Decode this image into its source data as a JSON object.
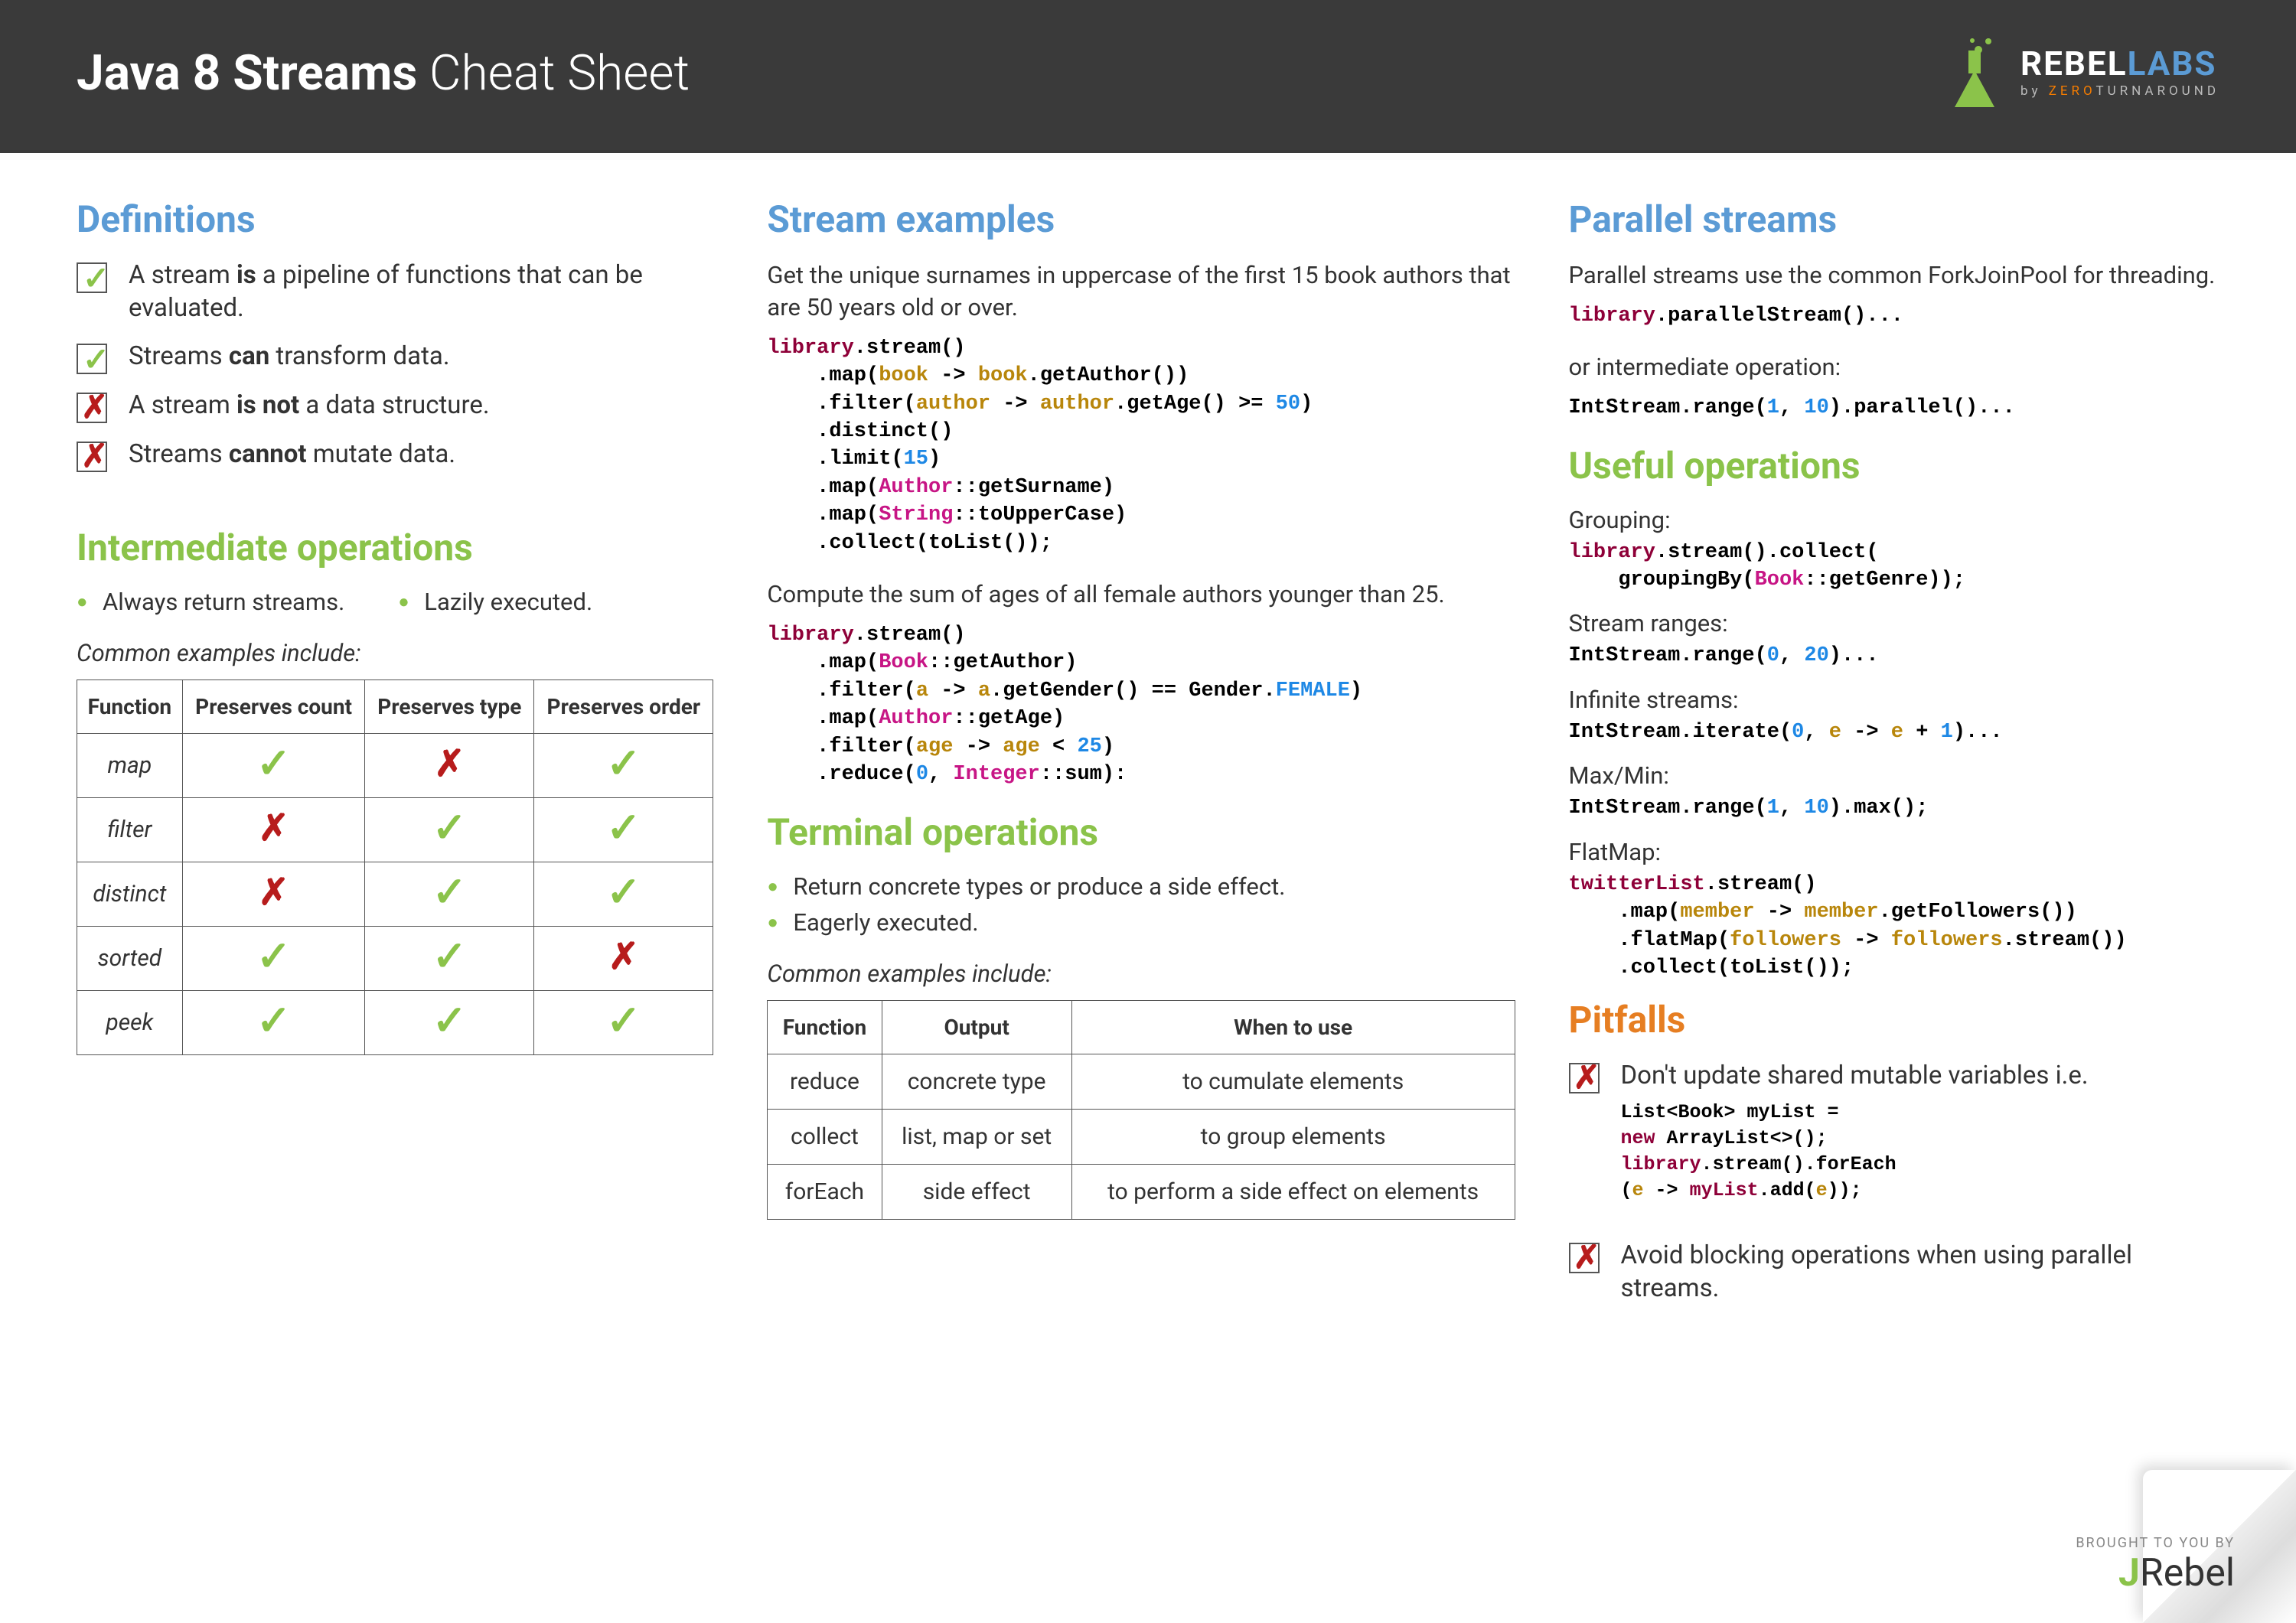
{
  "header": {
    "title_bold": "Java 8 Streams",
    "title_light": " Cheat Sheet",
    "logo_main": "REBEL",
    "logo_labs": "LABS",
    "logo_sub_by": "by ",
    "logo_sub_zero": "ZERO",
    "logo_sub_turn": "TURNAROUND"
  },
  "definitions": {
    "heading": "Definitions",
    "items": [
      {
        "ok": true,
        "html": "A stream <b>is</b> a pipeline of functions that can be evaluated."
      },
      {
        "ok": true,
        "html": "Streams <b>can</b> transform data."
      },
      {
        "ok": false,
        "html": "A stream <b>is not</b> a data structure."
      },
      {
        "ok": false,
        "html": "Streams <b>cannot</b> mutate data."
      }
    ]
  },
  "intermediate": {
    "heading": "Intermediate operations",
    "bullets": [
      "Always return streams.",
      "Lazily executed."
    ],
    "subhead": "Common examples include:",
    "table": {
      "headers": [
        "Function",
        "Preserves count",
        "Preserves type",
        "Preserves order"
      ],
      "rows": [
        {
          "fn": "map",
          "cells": [
            "✓",
            "✗",
            "✓"
          ]
        },
        {
          "fn": "filter",
          "cells": [
            "✗",
            "✓",
            "✓"
          ]
        },
        {
          "fn": "distinct",
          "cells": [
            "✗",
            "✓",
            "✓"
          ]
        },
        {
          "fn": "sorted",
          "cells": [
            "✓",
            "✓",
            "✗"
          ]
        },
        {
          "fn": "peek",
          "cells": [
            "✓",
            "✓",
            "✓"
          ]
        }
      ]
    }
  },
  "examples": {
    "heading": "Stream examples",
    "ex1_desc": "Get the unique surnames in uppercase of the first 15 book authors that are 50 years old or over.",
    "ex1_code": "<span class='c-obj'>library</span>.<b>stream()</b>\n    .<b>map</b>(<span class='c-var'>book</span> -&gt; <span class='c-var'>book</span>.getAuthor())\n    .<b>filter</b>(<span class='c-var'>author</span> -&gt; <span class='c-var'>author</span>.getAge() &gt;= <span class='c-num'>50</span>)\n    .<b>distinct</b>()\n    .<b>limit</b>(<span class='c-num'>15</span>)\n    .<b>map</b>(<span class='c-cls'>Author</span>::getSurname)\n    .<b>map</b>(<span class='c-cls'>String</span>::toUpperCase)\n    .<b>collect</b>(toList());",
    "ex2_desc": "Compute the sum of ages of all female authors younger than 25.",
    "ex2_code": "<span class='c-obj'>library</span>.<b>stream()</b>\n    .<b>map</b>(<span class='c-cls'>Book</span>::getAuthor)\n    .<b>filter</b>(<span class='c-var'>a</span> -&gt; <span class='c-var'>a</span>.getGender() == Gender.<span class='c-const'>FEMALE</span>)\n    .<b>map</b>(<span class='c-cls'>Author</span>::getAge)\n    .<b>filter</b>(<span class='c-var'>age</span> -&gt; <span class='c-var'>age</span> &lt; <span class='c-num'>25</span>)\n    .<b>reduce</b>(<span class='c-num'>0</span>, <span class='c-cls'>Integer</span>::sum):"
  },
  "terminal": {
    "heading": "Terminal operations",
    "bullets": [
      "Return concrete types or produce a side effect.",
      "Eagerly executed."
    ],
    "subhead": "Common examples include:",
    "table": {
      "headers": [
        "Function",
        "Output",
        "When to use"
      ],
      "rows": [
        {
          "fn": "reduce",
          "out": "concrete type",
          "use": "to cumulate elements"
        },
        {
          "fn": "collect",
          "out": "list, map or set",
          "use": "to group elements"
        },
        {
          "fn": "forEach",
          "out": "side effect",
          "use": "to perform a side effect on elements"
        }
      ]
    }
  },
  "parallel": {
    "heading": "Parallel streams",
    "desc1": "Parallel streams use the common ForkJoinPool for threading.",
    "code1": "<span class='c-obj'>library</span>.<b>parallelStream()</b>...",
    "desc2": "or intermediate operation:",
    "code2": "<b>IntStream.range</b>(<span class='c-num'>1</span>, <span class='c-num'>10</span>).<b>parallel()</b>..."
  },
  "useful": {
    "heading": "Useful operations",
    "ops": [
      {
        "label": "Grouping:",
        "code": "<span class='c-obj'>library</span>.<b>stream().collect(</b>\n    <b>groupingBy</b>(<span class='c-cls'>Book</span>::getGenre));"
      },
      {
        "label": "Stream ranges:",
        "code": "<b>IntStream.range</b>(<span class='c-num'>0</span>, <span class='c-num'>20</span>)..."
      },
      {
        "label": "Infinite streams:",
        "code": "<b>IntStream.iterate</b>(<span class='c-num'>0</span>, <span class='c-var'>e</span> -&gt; <span class='c-var'>e</span> + <span class='c-num'>1</span>)..."
      },
      {
        "label": "Max/Min:",
        "code": "<b>IntStream.range</b>(<span class='c-num'>1</span>, <span class='c-num'>10</span>).<b>max()</b>;"
      },
      {
        "label": "FlatMap:",
        "code": "<span class='c-obj'>twitterList</span>.<b>stream()</b>\n    .<b>map</b>(<span class='c-var'>member</span> -&gt; <span class='c-var'>member</span>.getFollowers())\n    .<b>flatMap</b>(<span class='c-var'>followers</span> -&gt; <span class='c-var'>followers</span>.stream())\n    .<b>collect</b>(toList());"
      }
    ]
  },
  "pitfalls": {
    "heading": "Pitfalls",
    "items": [
      {
        "text": "Don't update shared mutable variables i.e.",
        "code": "<b>List&lt;Book&gt; myList =</b>\n<span class='c-obj'>new</span> <b>ArrayList&lt;&gt;();</b>\n<span class='c-obj'>library</span>.<b>stream().forEach</b>\n(<span class='c-var'>e</span> -&gt; <span class='c-obj'>myList</span>.<b>add</b>(<span class='c-var'>e</span>));"
      },
      {
        "text": "Avoid blocking operations when using parallel streams.",
        "code": null
      }
    ]
  },
  "footer": {
    "brought": "BROUGHT TO YOU BY",
    "jrebel_j": "J",
    "jrebel_rest": "Rebel"
  }
}
